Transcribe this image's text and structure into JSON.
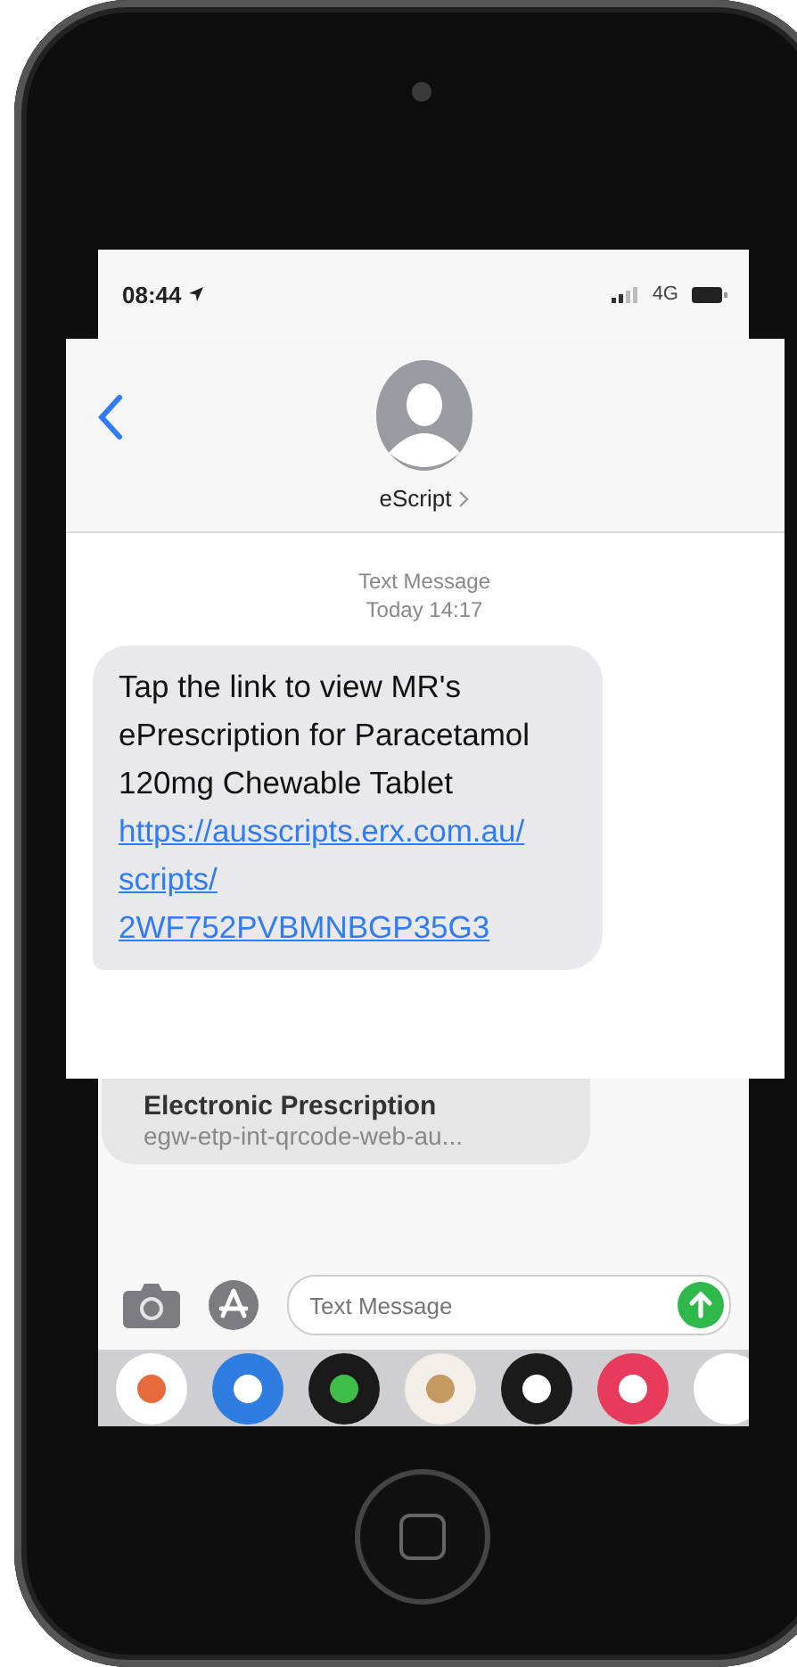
{
  "status_bar": {
    "time": "08:44",
    "network": "4G"
  },
  "header": {
    "contact": "eScript"
  },
  "thread": {
    "service": "Text Message",
    "timestamp": "Today 14:17"
  },
  "message": {
    "text": "Tap the link to view MR's ePrescription for Paracetamol 120mg Chewable Tablet",
    "link": "https://ausscripts.erx.com.au/scripts/2WF752PVBMNBGP35G3"
  },
  "link_preview": {
    "title": "Electronic Prescription",
    "subtitle": "egw-etp-int-qrcode-web-au..."
  },
  "composer": {
    "placeholder": "Text Message"
  }
}
